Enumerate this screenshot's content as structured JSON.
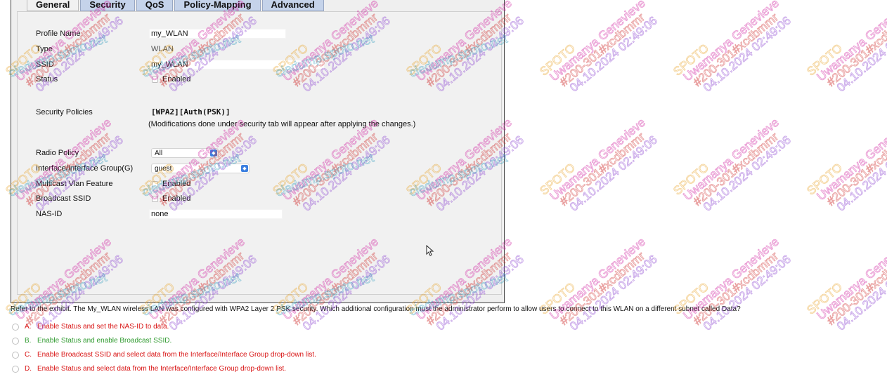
{
  "tabs": [
    "General",
    "Security",
    "QoS",
    "Policy-Mapping",
    "Advanced"
  ],
  "form": {
    "profile_name_label": "Profile Name",
    "profile_name_value": "my_WLAN",
    "type_label": "Type",
    "type_value": "WLAN",
    "ssid_label": "SSID",
    "ssid_value": "my_WLAN",
    "status_label": "Status",
    "status_enabled": "Enabled",
    "security_policies_label": "Security Policies",
    "security_policies_value": "[WPA2][Auth(PSK)]",
    "security_note": "(Modifications done under security tab will appear after applying the changes.)",
    "radio_policy_label": "Radio Policy",
    "radio_policy_value": "All",
    "interface_label": "Interface/Interface Group(G)",
    "interface_value": "guest",
    "multicast_label": "Multicast Vlan Feature",
    "multicast_enabled": "Enabled",
    "broadcast_label": "Broadcast SSID",
    "broadcast_enabled": "Enabled",
    "nas_id_label": "NAS-ID",
    "nas_id_value": "none"
  },
  "question": "Refer to the exhibit. The My_WLAN wireless LAN was configured with WPA2 Layer 2 PSK security. Which additional configuration must the administrator perform to allow users to connect to this WLAN on a different subnet called Data?",
  "options": [
    {
      "letter": "A.",
      "text": "Enable Status and set the NAS-ID to data."
    },
    {
      "letter": "B.",
      "text": "Enable Status and enable Broadcast SSID."
    },
    {
      "letter": "C.",
      "text": "Enable Broadcast SSID and select data from the Interface/Interface Group drop-down list."
    },
    {
      "letter": "D.",
      "text": "Enable Status and select data from the Interface/Interface Group drop-down list."
    }
  ],
  "colors": {
    "tab_blue": "#c5d3ea",
    "option_red": "#d81212",
    "option_green": "#2e9a2e",
    "select_arrow": "#3b7fe0"
  },
  "icons": {
    "select_arrow": "updown-chevron-icon",
    "cursor": "mouse-pointer-icon"
  },
  "watermark": {
    "site": "ciedump.spoto.net",
    "name": "Uwamanya Genevieve",
    "id": "#200-301#xcdbmmr",
    "time": "04.10.2024  02:49:06",
    "brand": "SPOTO"
  }
}
